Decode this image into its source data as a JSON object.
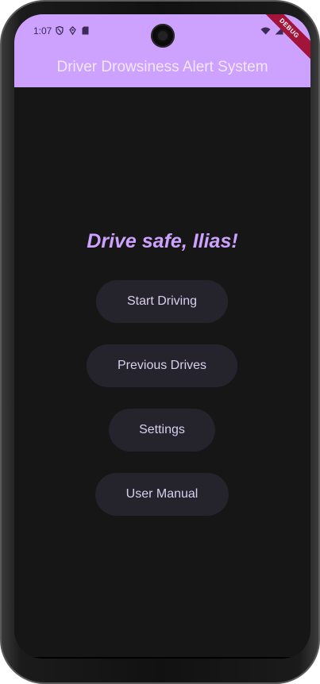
{
  "status_bar": {
    "time": "1:07",
    "debug_label": "DEBUG",
    "icons_left": [
      "shield-icon",
      "location-icon",
      "sd-card-icon"
    ],
    "icons_right": [
      "wifi-icon",
      "signal-icon",
      "battery-icon"
    ]
  },
  "appbar": {
    "title": "Driver Drowsiness Alert System",
    "color": "#cda2ff"
  },
  "main": {
    "greeting": "Drive safe, Ilias!",
    "buttons": [
      {
        "label": "Start Driving"
      },
      {
        "label": "Previous Drives"
      },
      {
        "label": "Settings"
      },
      {
        "label": "User Manual"
      }
    ]
  },
  "colors": {
    "background": "#161616",
    "button_bg": "#25232b",
    "button_text": "#d9d0ef",
    "accent": "#cda2ff"
  }
}
